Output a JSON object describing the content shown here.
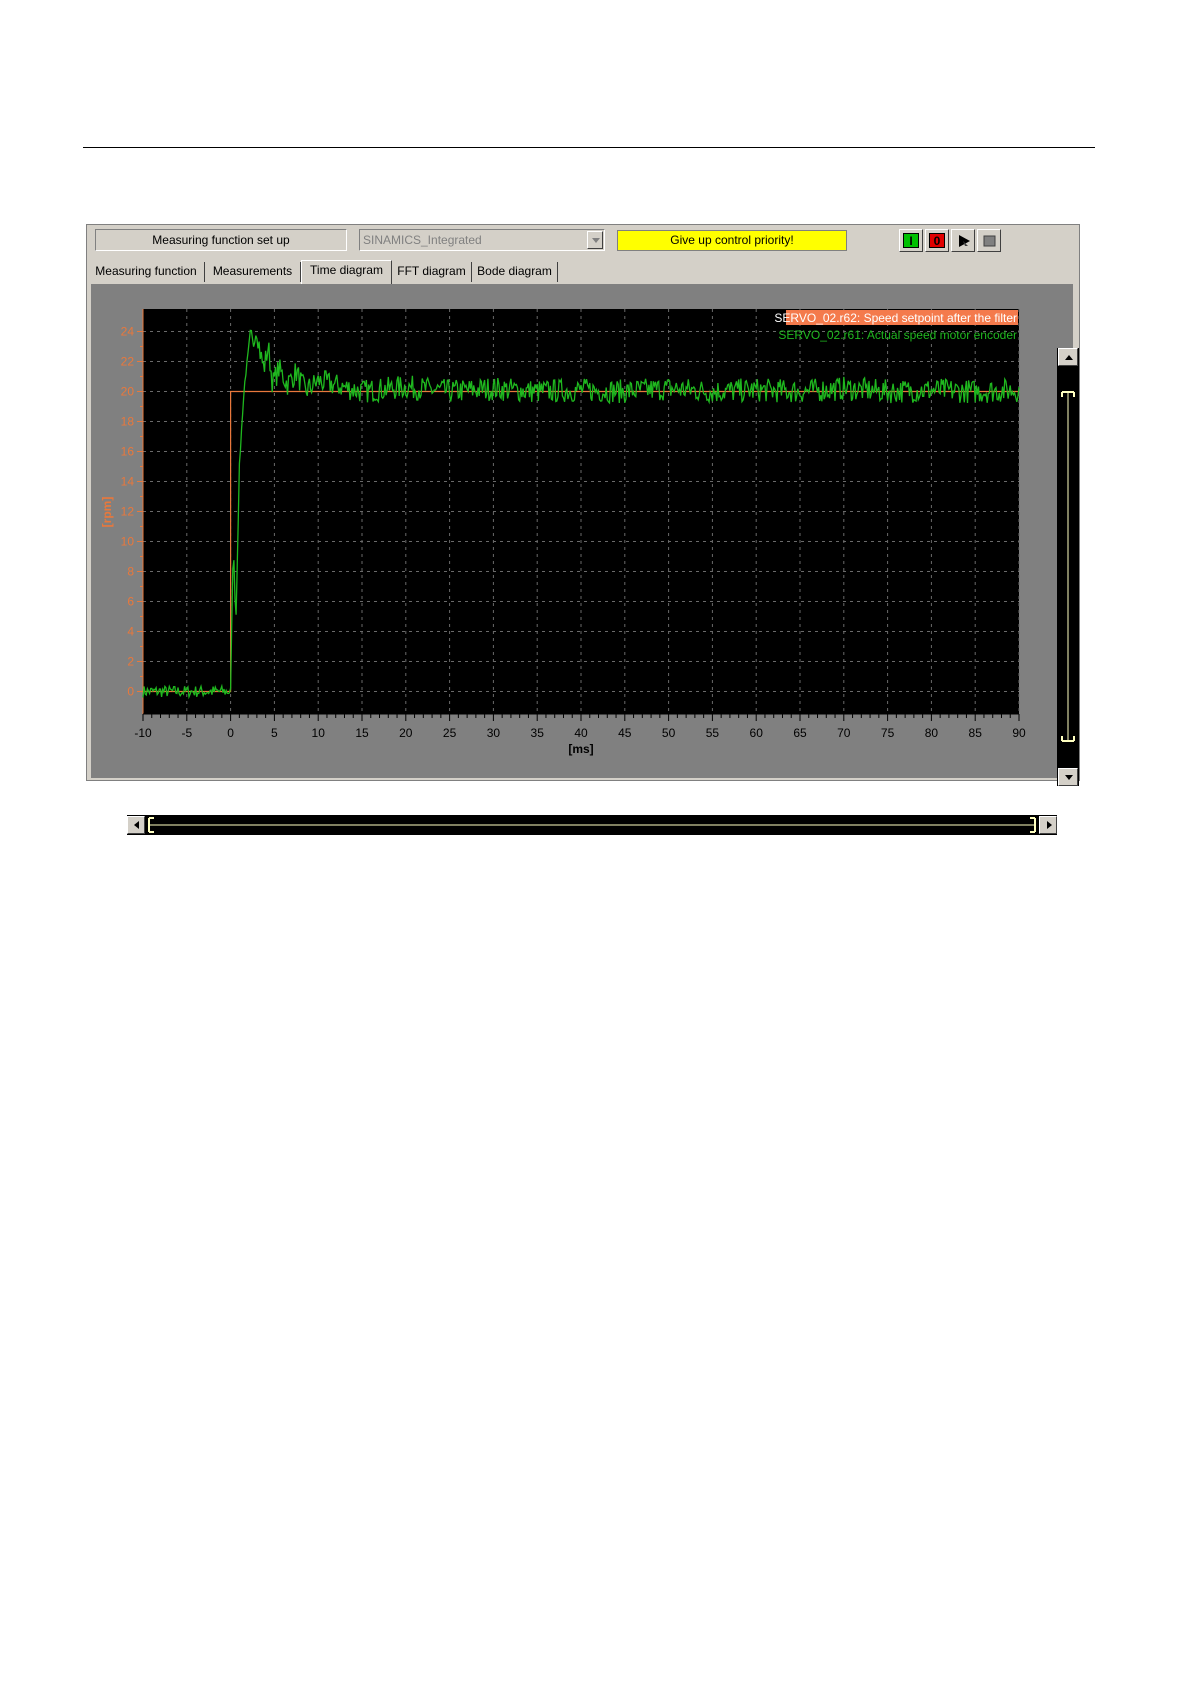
{
  "toolbar": {
    "status_label": "Measuring function set up",
    "device_value": "SINAMICS_Integrated",
    "priority_button_label": "Give up control priority!",
    "on_button_label": "I",
    "off_button_label": "0"
  },
  "tabs": [
    {
      "label": "Measuring function"
    },
    {
      "label": "Measurements"
    },
    {
      "label": "Time diagram",
      "selected": true
    },
    {
      "label": "FFT diagram"
    },
    {
      "label": "Bode diagram"
    }
  ],
  "colors": {
    "setpoint": "#e8783c",
    "actual": "#1fb81f",
    "plot_background": "#000000",
    "legend_highlight": "#f47a4c",
    "priority_button": "#ffff00"
  },
  "chart_data": {
    "type": "line",
    "xlabel": "[ms]",
    "ylabel": "[rpm]",
    "xlim": [
      -10,
      90
    ],
    "ylim": [
      -1.5,
      25.5
    ],
    "x_ticks": [
      -10,
      -5,
      0,
      5,
      10,
      15,
      20,
      25,
      30,
      35,
      40,
      45,
      50,
      55,
      60,
      65,
      70,
      75,
      80,
      85,
      90
    ],
    "y_ticks": [
      0,
      2,
      4,
      6,
      8,
      10,
      12,
      14,
      16,
      18,
      20,
      22,
      24
    ],
    "grid": true,
    "legend_position": "top-right",
    "series": [
      {
        "name": "SERVO_02.r62: Speed setpoint after the filter",
        "x": [
          -10,
          0,
          0,
          90
        ],
        "y": [
          0,
          0,
          20,
          20
        ]
      },
      {
        "name": "SERVO_02.r61: Actual speed motor encoder",
        "x": [
          -10,
          -7,
          -5,
          -3,
          -1,
          0,
          0.3,
          0.6,
          1,
          1.3,
          1.6,
          2,
          2.3,
          2.6,
          3,
          3.4,
          3.8,
          4.3,
          4.8,
          5.5,
          6.5,
          7.5,
          8.5,
          10,
          15,
          20,
          25,
          30,
          35,
          40,
          45,
          50,
          55,
          60,
          65,
          70,
          75,
          80,
          85,
          90
        ],
        "y": [
          0,
          0,
          0,
          0,
          0,
          0,
          10,
          4.5,
          15,
          18,
          20.5,
          22.5,
          24.2,
          23,
          24.2,
          22.5,
          21.5,
          23,
          20.5,
          21.5,
          20.5,
          21.3,
          20,
          20.7,
          20,
          20.3,
          20,
          20.2,
          20,
          20.1,
          20,
          20.2,
          20,
          20.1,
          20,
          20.2,
          20,
          20.1,
          20,
          20.1
        ]
      }
    ]
  }
}
